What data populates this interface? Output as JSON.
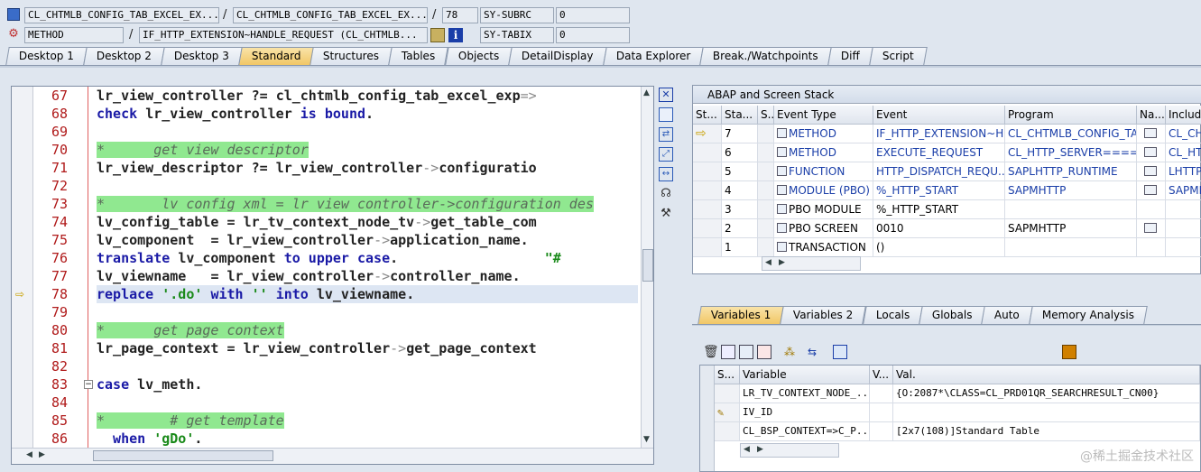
{
  "header": {
    "row1": {
      "program": "CL_CHTMLB_CONFIG_TAB_EXCEL_EX...",
      "include": "CL_CHTMLB_CONFIG_TAB_EXCEL_EX...",
      "line": "78",
      "sysfield_name": "SY-SUBRC",
      "sysfield_value": "0",
      "sep1": "/",
      "sep2": "/"
    },
    "row2": {
      "type": "METHOD",
      "event": "IF_HTTP_EXTENSION~HANDLE_REQUEST (CL_CHTMLB...",
      "sysfield_name": "SY-TABIX",
      "sysfield_value": "0",
      "sep1": "/"
    }
  },
  "tabs": [
    "Desktop 1",
    "Desktop 2",
    "Desktop 3",
    "Standard",
    "Structures",
    "Tables",
    "Objects",
    "DetailDisplay",
    "Data Explorer",
    "Break./Watchpoints",
    "Diff",
    "Script"
  ],
  "active_tab": "Standard",
  "code": [
    {
      "n": "67",
      "parts": [
        [
          "id",
          "lr_view_controller "
        ],
        [
          "op",
          "?= "
        ],
        [
          "id",
          "cl_chtmlb_config_tab_excel_exp"
        ],
        [
          "arrow",
          "=>"
        ]
      ]
    },
    {
      "n": "68",
      "parts": [
        [
          "kw",
          "check "
        ],
        [
          "id",
          "lr_view_controller "
        ],
        [
          "kw",
          "is bound"
        ],
        [
          "op",
          "."
        ]
      ]
    },
    {
      "n": "69",
      "parts": []
    },
    {
      "n": "70",
      "parts": [
        [
          "cm",
          "*      get view descriptor"
        ]
      ]
    },
    {
      "n": "71",
      "parts": [
        [
          "id",
          "lr_view_descriptor "
        ],
        [
          "op",
          "?= "
        ],
        [
          "id",
          "lr_view_controller"
        ],
        [
          "arrow",
          "->"
        ],
        [
          "id",
          "configuratio"
        ]
      ]
    },
    {
      "n": "72",
      "parts": []
    },
    {
      "n": "73",
      "parts": [
        [
          "cm",
          "*       lv config xml = lr view controller->configuration des"
        ]
      ]
    },
    {
      "n": "74",
      "parts": [
        [
          "id",
          "lv_config_table "
        ],
        [
          "op",
          "= "
        ],
        [
          "id",
          "lr_tv_context_node_tv"
        ],
        [
          "arrow",
          "->"
        ],
        [
          "id",
          "get_table_com"
        ]
      ]
    },
    {
      "n": "75",
      "parts": [
        [
          "id",
          "lv_component  "
        ],
        [
          "op",
          "= "
        ],
        [
          "id",
          "lr_view_controller"
        ],
        [
          "arrow",
          "->"
        ],
        [
          "id",
          "application_name"
        ],
        [
          "op",
          "."
        ]
      ]
    },
    {
      "n": "76",
      "parts": [
        [
          "kw",
          "translate "
        ],
        [
          "id",
          "lv_component "
        ],
        [
          "kw",
          "to upper case"
        ],
        [
          "op",
          "."
        ],
        [
          "str",
          "                  \"#"
        ]
      ]
    },
    {
      "n": "77",
      "parts": [
        [
          "id",
          "lv_viewname   "
        ],
        [
          "op",
          "= "
        ],
        [
          "id",
          "lr_view_controller"
        ],
        [
          "arrow",
          "->"
        ],
        [
          "id",
          "controller_name"
        ],
        [
          "op",
          "."
        ]
      ]
    },
    {
      "n": "78",
      "parts": [
        [
          "kw",
          "replace "
        ],
        [
          "str",
          "'.do' "
        ],
        [
          "kw",
          "with "
        ],
        [
          "str",
          "'' "
        ],
        [
          "kw",
          "into "
        ],
        [
          "id",
          "lv_viewname"
        ],
        [
          "op",
          "."
        ]
      ]
    },
    {
      "n": "79",
      "parts": []
    },
    {
      "n": "80",
      "parts": [
        [
          "cm",
          "*      get page context"
        ]
      ]
    },
    {
      "n": "81",
      "parts": [
        [
          "id",
          "lr_page_context "
        ],
        [
          "op",
          "= "
        ],
        [
          "id",
          "lr_view_controller"
        ],
        [
          "arrow",
          "->"
        ],
        [
          "id",
          "get_page_context"
        ]
      ]
    },
    {
      "n": "82",
      "parts": []
    },
    {
      "n": "83",
      "parts": [
        [
          "kw",
          "case "
        ],
        [
          "id",
          "lv_meth"
        ],
        [
          "op",
          "."
        ]
      ]
    },
    {
      "n": "84",
      "parts": []
    },
    {
      "n": "85",
      "parts": [
        [
          "cm",
          "*        # get template"
        ]
      ]
    },
    {
      "n": "86",
      "parts": [
        [
          "kw",
          "  when "
        ],
        [
          "str",
          "'gDo'"
        ],
        [
          "op",
          "."
        ]
      ]
    }
  ],
  "stack": {
    "title": "ABAP and Screen Stack",
    "columns": [
      "St...",
      "Sta...",
      "S...",
      "Event Type",
      "Event",
      "Program",
      "Na...",
      "Include"
    ],
    "rows": [
      {
        "level": "7",
        "type": "METHOD",
        "event": "IF_HTTP_EXTENSION~H...",
        "program": "CL_CHTMLB_CONFIG_TA...",
        "include": "CL_CHT",
        "current": true
      },
      {
        "level": "6",
        "type": "METHOD",
        "event": "EXECUTE_REQUEST",
        "program": "CL_HTTP_SERVER====...",
        "include": "CL_HT"
      },
      {
        "level": "5",
        "type": "FUNCTION",
        "event": "HTTP_DISPATCH_REQU...",
        "program": "SAPLHTTP_RUNTIME",
        "include": "LHTTP"
      },
      {
        "level": "4",
        "type": "MODULE (PBO)",
        "event": "%_HTTP_START",
        "program": "SAPMHTTP",
        "include": "SAPMH"
      },
      {
        "level": "3",
        "type": "PBO MODULE",
        "event": "%_HTTP_START",
        "program": "",
        "include": ""
      },
      {
        "level": "2",
        "type": "PBO SCREEN",
        "event": "0010",
        "program": "SAPMHTTP",
        "include": ""
      },
      {
        "level": "1",
        "type": "TRANSACTION",
        "event": "()",
        "program": "",
        "include": ""
      }
    ]
  },
  "vars": {
    "tabs": [
      "Variables 1",
      "Variables 2",
      "Locals",
      "Globals",
      "Auto",
      "Memory Analysis"
    ],
    "active_tab": "Variables 1",
    "columns": [
      "S...",
      "Variable",
      "V...",
      "Val."
    ],
    "rows": [
      {
        "variable": "LR_TV_CONTEXT_NODE_...",
        "value": "{O:2087*\\CLASS=CL_PRD01QR_SEARCHRESULT_CN00}"
      },
      {
        "variable": "IV_ID",
        "value": ""
      },
      {
        "variable": "CL_BSP_CONTEXT=>C_P...",
        "value": "[2x7(108)]Standard Table"
      }
    ]
  },
  "watermark": "@稀土掘金技术社区"
}
